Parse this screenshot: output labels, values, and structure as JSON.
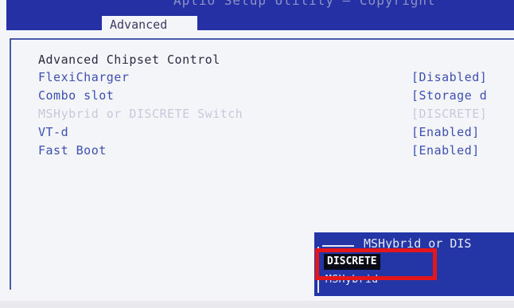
{
  "topbar": {
    "title": "Aptio Setup Utility – Copyright"
  },
  "tabs": {
    "active": "Advanced"
  },
  "section": {
    "heading": "Advanced Chipset Control"
  },
  "settings": [
    {
      "label": "FlexiCharger",
      "value": "[Disabled]"
    },
    {
      "label": "Combo slot",
      "value": "[Storage d"
    },
    {
      "label": "MSHybrid or DISCRETE Switch",
      "value": "[DISCRETE]"
    },
    {
      "label": "VT-d",
      "value": "[Enabled]"
    },
    {
      "label": "Fast Boot",
      "value": "[Enabled]"
    }
  ],
  "popup": {
    "title": "MSHybrid or DIS",
    "options": [
      "DISCRETE",
      "MSHybrid"
    ],
    "selected": "DISCRETE"
  },
  "colors": {
    "bios_blue": "#2436a6",
    "text_blue": "#3d4fb3",
    "highlight_red": "#e4161a",
    "selection_black": "#0b0b18"
  }
}
